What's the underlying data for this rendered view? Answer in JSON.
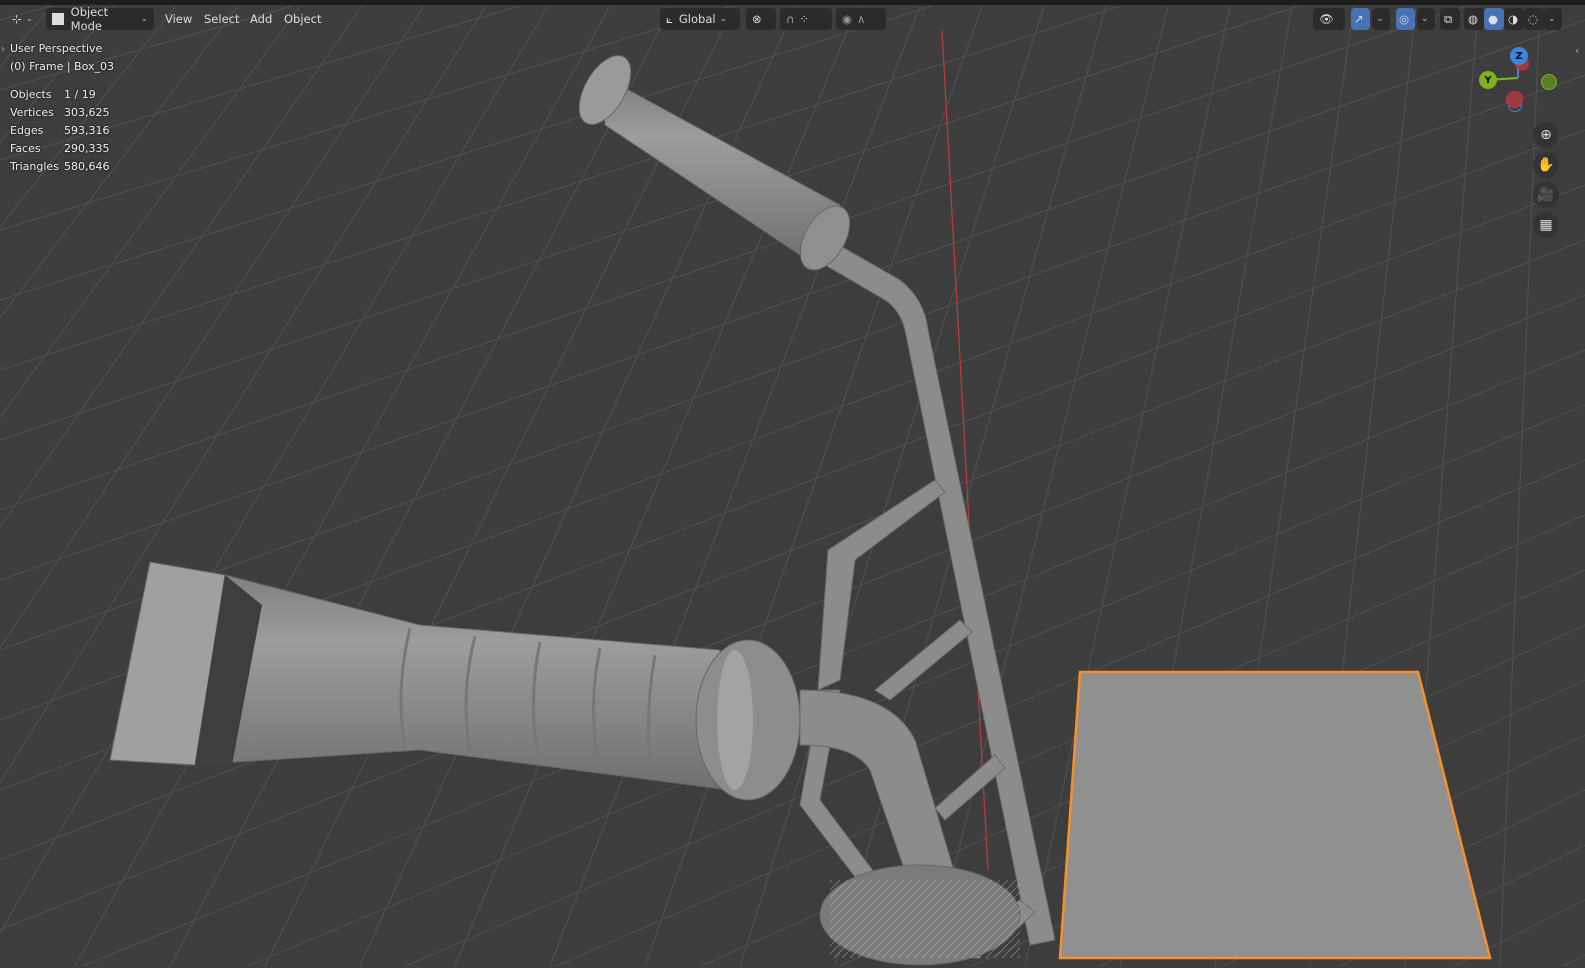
{
  "header": {
    "editor_type_icon": "view3d-icon",
    "mode": "Object Mode",
    "menus": [
      "View",
      "Select",
      "Add",
      "Object"
    ],
    "orientation": "Global"
  },
  "overlay": {
    "view_name": "User Perspective",
    "context": "(0) Frame | Box_03",
    "stats": [
      {
        "label": "Objects",
        "value": "1 / 19"
      },
      {
        "label": "Vertices",
        "value": "303,625"
      },
      {
        "label": "Edges",
        "value": "593,316"
      },
      {
        "label": "Faces",
        "value": "290,335"
      },
      {
        "label": "Triangles",
        "value": "580,646"
      }
    ]
  },
  "gizmo": {
    "z": "Z",
    "y": "Y"
  },
  "colors": {
    "selection": "#f5902a",
    "axis_x": "#c8333f",
    "axis_y": "#7fb51c",
    "axis_z": "#3f84de",
    "active": "#4772b3"
  }
}
